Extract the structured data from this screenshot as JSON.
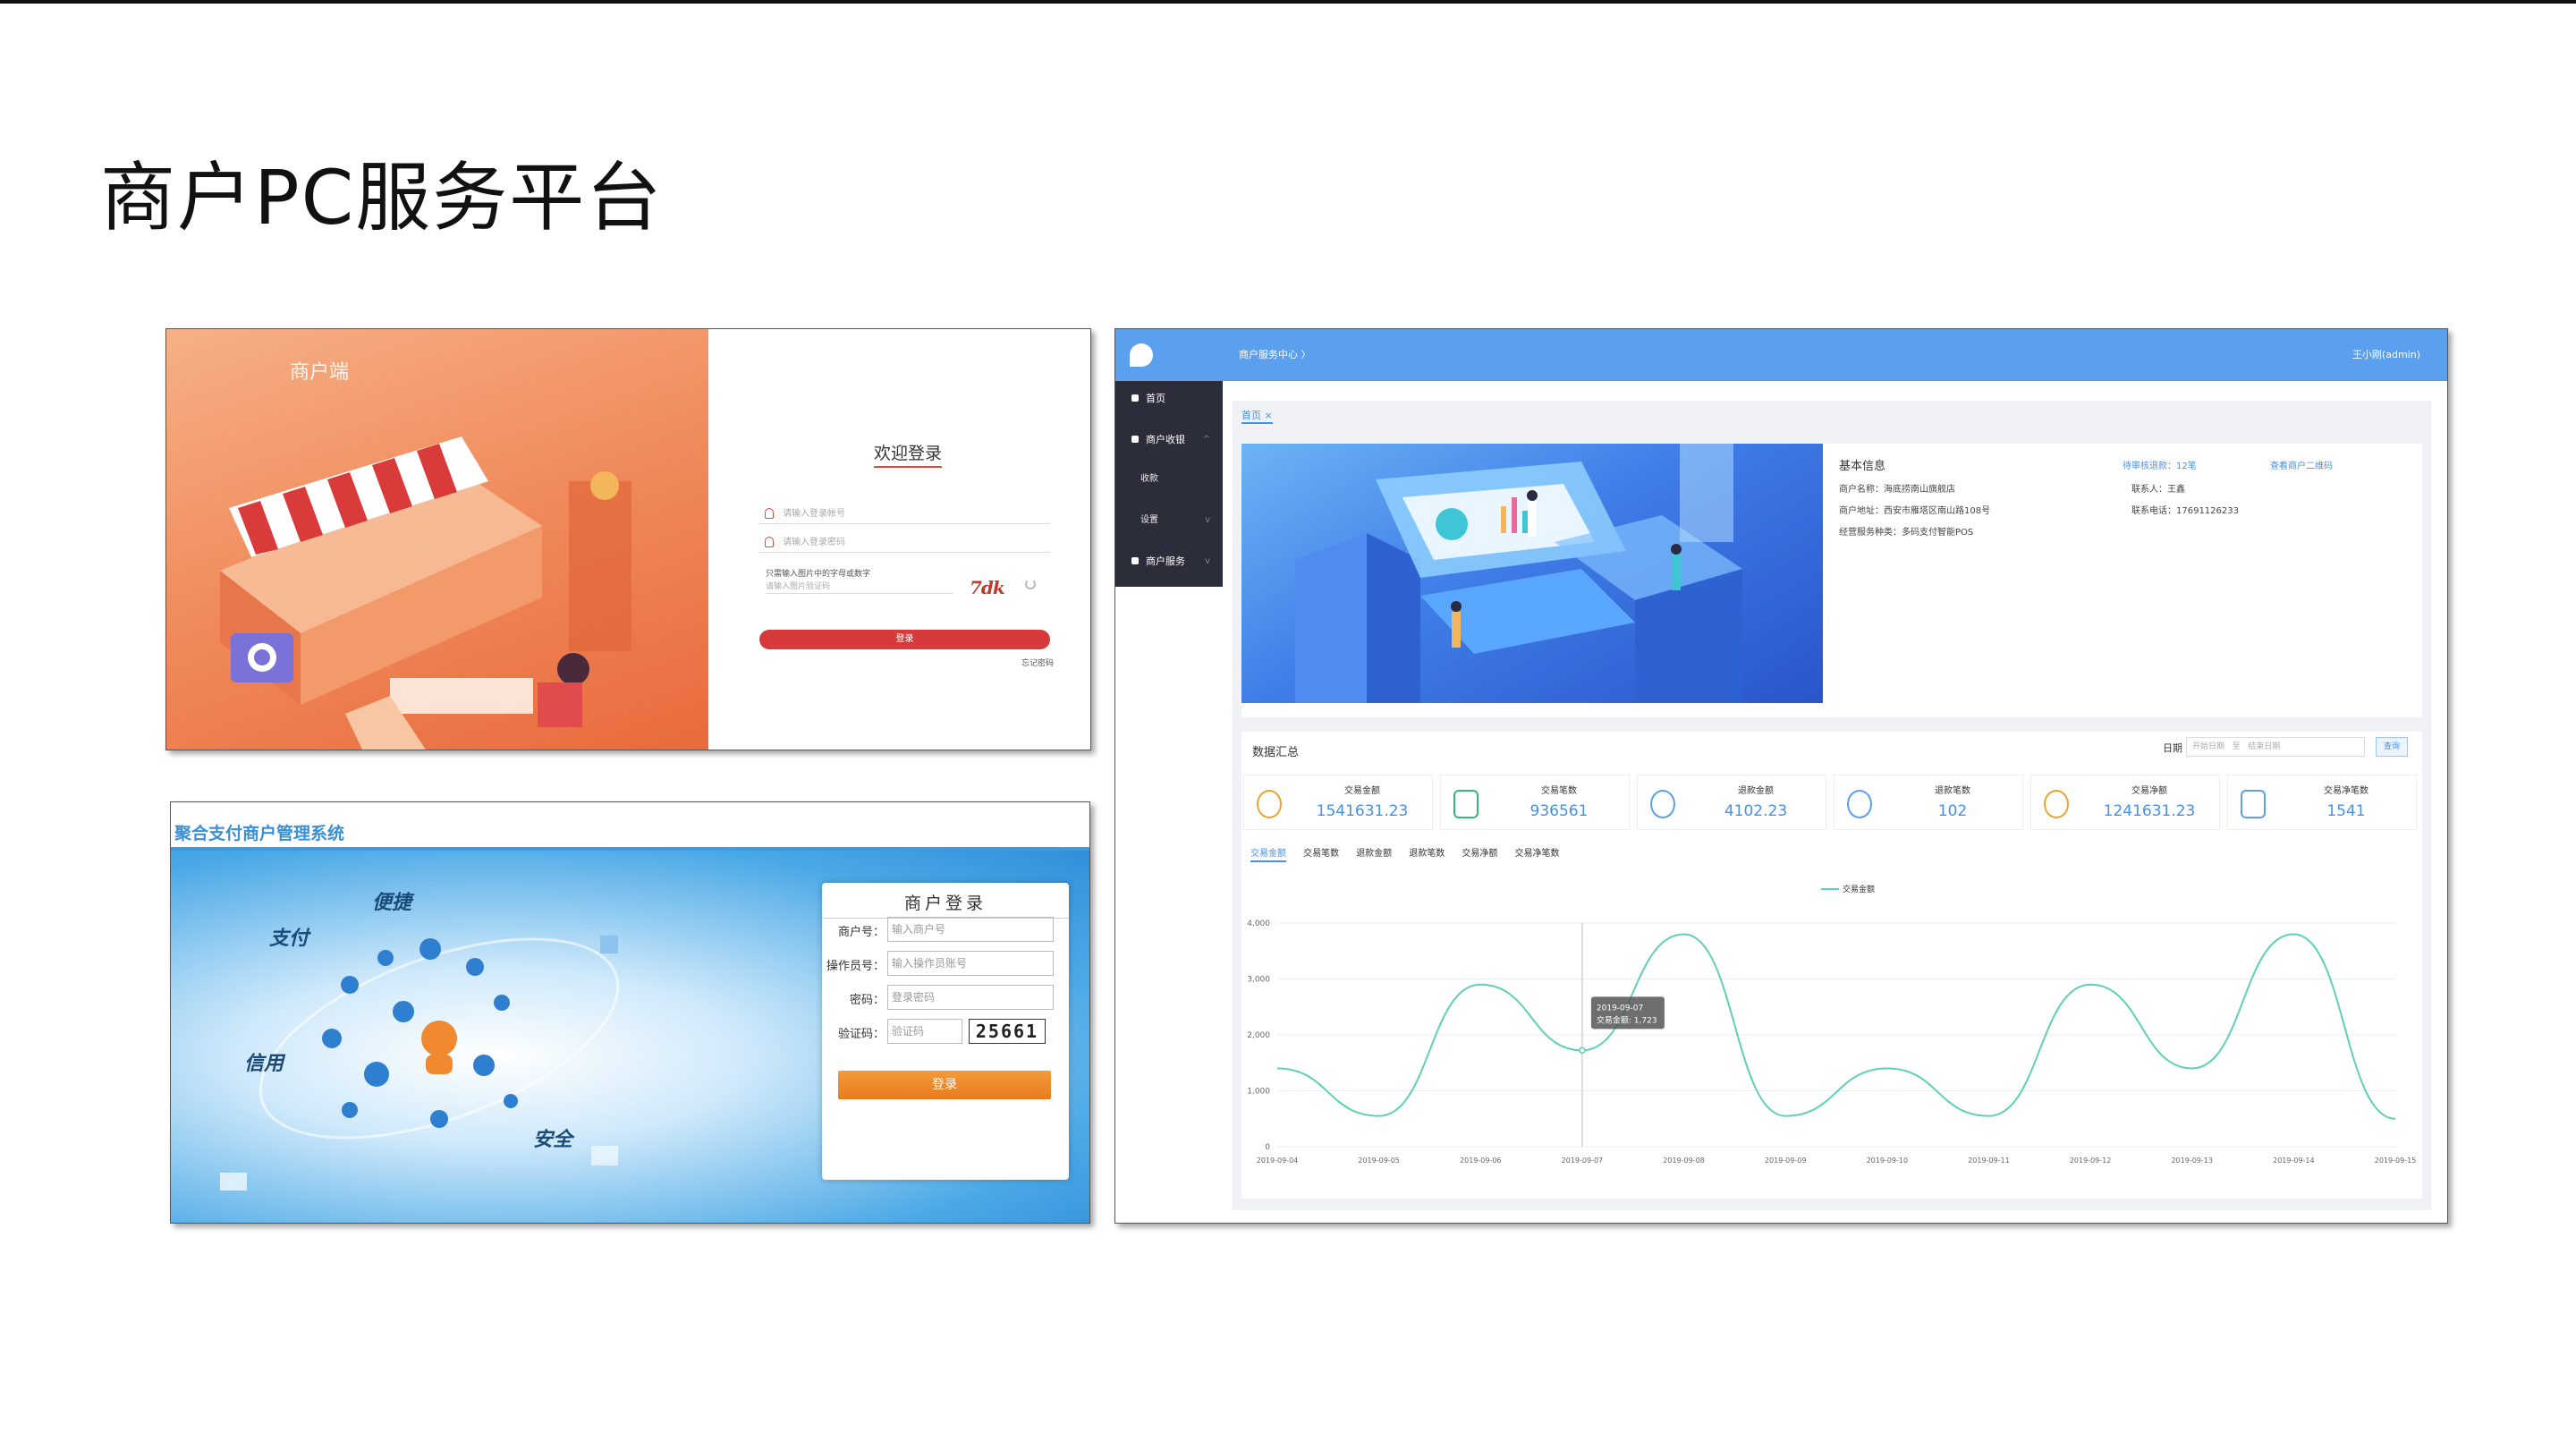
{
  "slide": {
    "title": "商户PC服务平台"
  },
  "orange_login": {
    "brand": "商户端",
    "welcome": "欢迎登录",
    "account_placeholder": "请输入登录帐号",
    "password_placeholder": "请输入登录密码",
    "captcha_note": "只需输入图片中的字母或数字",
    "captcha_placeholder": "请输入图片验证码",
    "captcha_image": "7dk",
    "login_button": "登录",
    "forgot_link": "忘记密码",
    "colors": {
      "primary": "#d63a3a",
      "art_bg": "#f08a5a"
    }
  },
  "blue_login": {
    "system_title": "聚合支付商户管理系统",
    "decor_words": [
      "便捷",
      "支付",
      "信用",
      "安全"
    ],
    "box_title": "商户登录",
    "fields": [
      {
        "label": "商户号：",
        "placeholder": "输入商户号"
      },
      {
        "label": "操作员号：",
        "placeholder": "输入操作员账号"
      },
      {
        "label": "密码：",
        "placeholder": "登录密码"
      }
    ],
    "captcha": {
      "label": "验证码：",
      "placeholder": "验证码",
      "code": "25661"
    },
    "login_button": "登录",
    "colors": {
      "header": "#3a8fd6",
      "button": "#e87c1f"
    }
  },
  "dashboard": {
    "crumb": "商户服务中心 〉",
    "user": "王小刚(admin)",
    "sidebar": [
      {
        "label": "首页",
        "icon": "home-icon"
      },
      {
        "label": "商户收银",
        "icon": "dollar-icon"
      },
      {
        "label": "收款",
        "icon": ""
      },
      {
        "label": "设置",
        "icon": ""
      },
      {
        "label": "商户服务",
        "icon": "dollar-icon"
      }
    ],
    "tab": "首页 ×",
    "basic_info": {
      "title": "基本信息",
      "merchant_name": "商户名称：海底捞南山旗舰店",
      "address": "商户地址：西安市雁塔区南山路108号",
      "service_type": "经营服务种类：多码支付智能POS",
      "pending_link": "待审核退款：12笔",
      "contact": "联系人：王鑫",
      "phone": "联系电话：17691126233",
      "qr_link": "查看商户二维码"
    },
    "summary": {
      "title": "数据汇总",
      "date_label": "日期",
      "start_placeholder": "开始日期",
      "sep": "至",
      "end_placeholder": "结束日期",
      "query_button": "查询",
      "stats": [
        {
          "label": "交易金额",
          "value": "1541631.23",
          "icon": "money-bag-icon"
        },
        {
          "label": "交易笔数",
          "value": "936561",
          "icon": "trend-chart-icon"
        },
        {
          "label": "退款金额",
          "value": "4102.23",
          "icon": "yen-icon"
        },
        {
          "label": "退款笔数",
          "value": "102",
          "icon": "yen-icon"
        },
        {
          "label": "交易净额",
          "value": "1241631.23",
          "icon": "coins-icon"
        },
        {
          "label": "交易净笔数",
          "value": "1541",
          "icon": "document-icon"
        }
      ],
      "tabs": [
        "交易金额",
        "交易笔数",
        "退款金额",
        "退款笔数",
        "交易净额",
        "交易净笔数"
      ]
    },
    "colors": {
      "topbar": "#5aa0ee",
      "sidebar": "#2b2d3b",
      "accent": "#4a8fe0",
      "line": "#5fcfb6"
    }
  },
  "chart_data": {
    "type": "line",
    "legend": "交易金额",
    "x": [
      "2019-09-04",
      "2019-09-05",
      "2019-09-06",
      "2019-09-07",
      "2019-09-08",
      "2019-09-09",
      "2019-09-10",
      "2019-09-11",
      "2019-09-12",
      "2019-09-13",
      "2019-09-14",
      "2019-09-15"
    ],
    "series": [
      {
        "name": "交易金额",
        "values": [
          1400,
          550,
          2900,
          1723,
          3800,
          550,
          1400,
          550,
          2900,
          1400,
          3800,
          500
        ]
      }
    ],
    "ylim": [
      0,
      4000
    ],
    "yticks": [
      "0",
      "1,000",
      "2,000",
      "3,000",
      "4,000"
    ],
    "tooltip": {
      "date": "2019-09-07",
      "text": "交易金额: 1,723"
    }
  }
}
